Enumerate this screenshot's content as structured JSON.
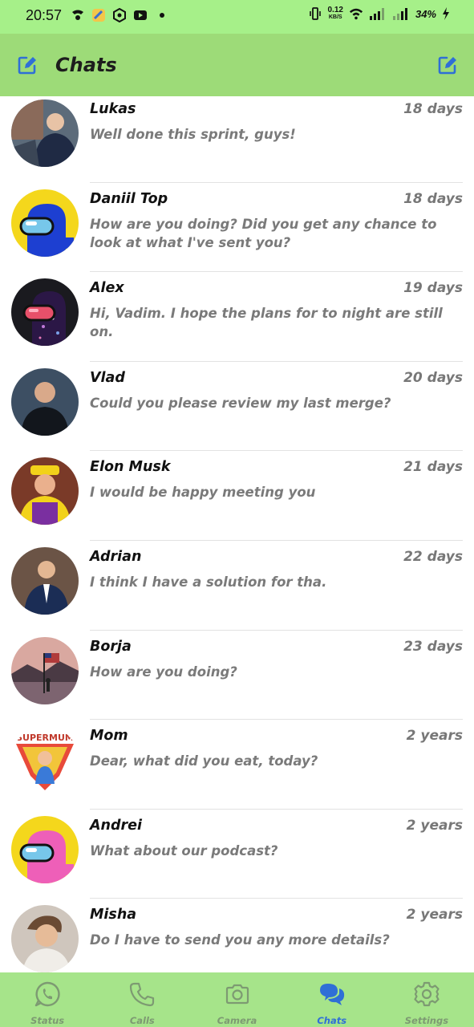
{
  "status_bar": {
    "time": "20:57",
    "net_speed_value": "0.12",
    "net_speed_unit": "KB/S",
    "battery": "34%"
  },
  "app_bar": {
    "title": "Chats",
    "left_icon": "compose-icon",
    "right_icon": "compose-icon"
  },
  "chats": [
    {
      "name": "Lukas",
      "time": "18 days",
      "message": "Well done this sprint, guys!"
    },
    {
      "name": "Daniil Top",
      "time": "18 days",
      "message": "How are you doing? Did you get any chance to look at what I've sent you?"
    },
    {
      "name": "Alex",
      "time": "19 days",
      "message": "Hi, Vadim. I hope the plans for to night are still on."
    },
    {
      "name": "Vlad",
      "time": "20 days",
      "message": "Could you please review my last merge?"
    },
    {
      "name": "Elon Musk",
      "time": "21 days",
      "message": "I would be happy meeting you"
    },
    {
      "name": "Adrian",
      "time": "22 days",
      "message": "I think I have a solution for tha."
    },
    {
      "name": "Borja",
      "time": "23 days",
      "message": "How are you doing?"
    },
    {
      "name": "Mom",
      "time": "2 years",
      "message": "Dear, what did you eat, today?"
    },
    {
      "name": "Andrei",
      "time": "2 years",
      "message": "What about our podcast?"
    },
    {
      "name": "Misha",
      "time": "2 years",
      "message": "Do I have to send you any more details?"
    }
  ],
  "bottom_nav": {
    "items": [
      {
        "label": "Status",
        "icon": "whatsapp-status-icon"
      },
      {
        "label": "Calls",
        "icon": "phone-icon"
      },
      {
        "label": "Camera",
        "icon": "camera-icon"
      },
      {
        "label": "Chats",
        "icon": "chat-bubbles-icon"
      },
      {
        "label": "Settings",
        "icon": "gear-icon"
      }
    ],
    "active": "Chats"
  },
  "colors": {
    "status_bar": "#a6f089",
    "app_bar": "#9ddb78",
    "bottom_nav": "#a6e48a",
    "accent_blue": "#2f6fd6"
  }
}
